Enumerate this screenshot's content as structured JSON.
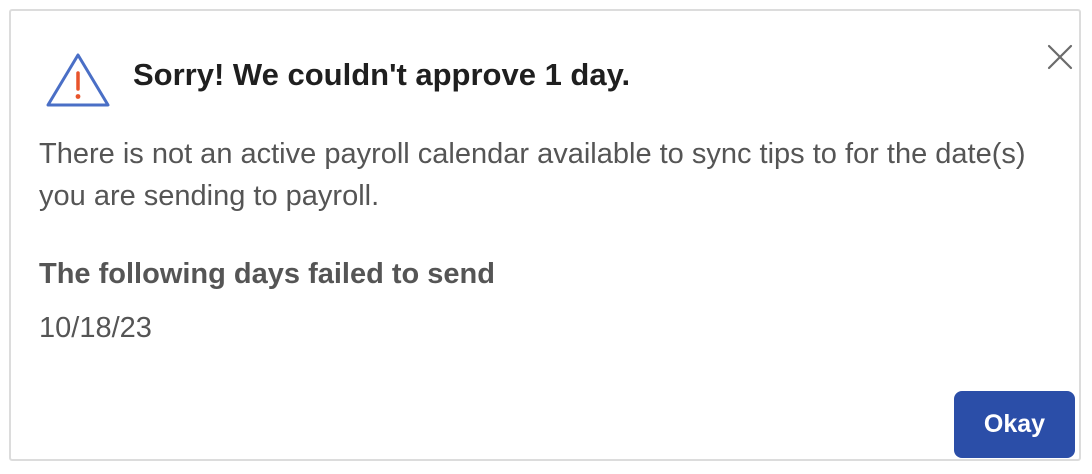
{
  "dialog": {
    "title": "Sorry! We couldn't approve 1 day.",
    "icon": "warning-triangle-icon",
    "close_icon": "close-icon",
    "message": "There is not an active payroll calendar available to sync tips to for the date(s) you are sending to payroll.",
    "failed_heading": "The following days failed to send",
    "failed_dates": [
      "10/18/23"
    ],
    "okay_label": "Okay"
  },
  "colors": {
    "icon_outline": "#4a6fc6",
    "icon_exclamation": "#e8542b",
    "button_bg": "#2b4ea8",
    "title_text": "#1f1f1f",
    "body_text": "#555555",
    "border": "#dcdcdc"
  }
}
